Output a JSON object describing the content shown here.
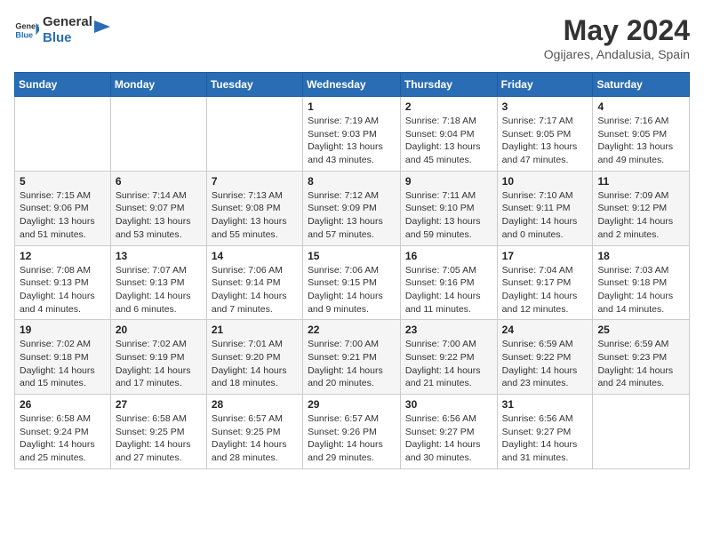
{
  "header": {
    "logo_general": "General",
    "logo_blue": "Blue",
    "month": "May 2024",
    "location": "Ogijares, Andalusia, Spain"
  },
  "weekdays": [
    "Sunday",
    "Monday",
    "Tuesday",
    "Wednesday",
    "Thursday",
    "Friday",
    "Saturday"
  ],
  "weeks": [
    [
      {
        "day": "",
        "info": ""
      },
      {
        "day": "",
        "info": ""
      },
      {
        "day": "",
        "info": ""
      },
      {
        "day": "1",
        "info": "Sunrise: 7:19 AM\nSunset: 9:03 PM\nDaylight: 13 hours\nand 43 minutes."
      },
      {
        "day": "2",
        "info": "Sunrise: 7:18 AM\nSunset: 9:04 PM\nDaylight: 13 hours\nand 45 minutes."
      },
      {
        "day": "3",
        "info": "Sunrise: 7:17 AM\nSunset: 9:05 PM\nDaylight: 13 hours\nand 47 minutes."
      },
      {
        "day": "4",
        "info": "Sunrise: 7:16 AM\nSunset: 9:05 PM\nDaylight: 13 hours\nand 49 minutes."
      }
    ],
    [
      {
        "day": "5",
        "info": "Sunrise: 7:15 AM\nSunset: 9:06 PM\nDaylight: 13 hours\nand 51 minutes."
      },
      {
        "day": "6",
        "info": "Sunrise: 7:14 AM\nSunset: 9:07 PM\nDaylight: 13 hours\nand 53 minutes."
      },
      {
        "day": "7",
        "info": "Sunrise: 7:13 AM\nSunset: 9:08 PM\nDaylight: 13 hours\nand 55 minutes."
      },
      {
        "day": "8",
        "info": "Sunrise: 7:12 AM\nSunset: 9:09 PM\nDaylight: 13 hours\nand 57 minutes."
      },
      {
        "day": "9",
        "info": "Sunrise: 7:11 AM\nSunset: 9:10 PM\nDaylight: 13 hours\nand 59 minutes."
      },
      {
        "day": "10",
        "info": "Sunrise: 7:10 AM\nSunset: 9:11 PM\nDaylight: 14 hours\nand 0 minutes."
      },
      {
        "day": "11",
        "info": "Sunrise: 7:09 AM\nSunset: 9:12 PM\nDaylight: 14 hours\nand 2 minutes."
      }
    ],
    [
      {
        "day": "12",
        "info": "Sunrise: 7:08 AM\nSunset: 9:13 PM\nDaylight: 14 hours\nand 4 minutes."
      },
      {
        "day": "13",
        "info": "Sunrise: 7:07 AM\nSunset: 9:13 PM\nDaylight: 14 hours\nand 6 minutes."
      },
      {
        "day": "14",
        "info": "Sunrise: 7:06 AM\nSunset: 9:14 PM\nDaylight: 14 hours\nand 7 minutes."
      },
      {
        "day": "15",
        "info": "Sunrise: 7:06 AM\nSunset: 9:15 PM\nDaylight: 14 hours\nand 9 minutes."
      },
      {
        "day": "16",
        "info": "Sunrise: 7:05 AM\nSunset: 9:16 PM\nDaylight: 14 hours\nand 11 minutes."
      },
      {
        "day": "17",
        "info": "Sunrise: 7:04 AM\nSunset: 9:17 PM\nDaylight: 14 hours\nand 12 minutes."
      },
      {
        "day": "18",
        "info": "Sunrise: 7:03 AM\nSunset: 9:18 PM\nDaylight: 14 hours\nand 14 minutes."
      }
    ],
    [
      {
        "day": "19",
        "info": "Sunrise: 7:02 AM\nSunset: 9:18 PM\nDaylight: 14 hours\nand 15 minutes."
      },
      {
        "day": "20",
        "info": "Sunrise: 7:02 AM\nSunset: 9:19 PM\nDaylight: 14 hours\nand 17 minutes."
      },
      {
        "day": "21",
        "info": "Sunrise: 7:01 AM\nSunset: 9:20 PM\nDaylight: 14 hours\nand 18 minutes."
      },
      {
        "day": "22",
        "info": "Sunrise: 7:00 AM\nSunset: 9:21 PM\nDaylight: 14 hours\nand 20 minutes."
      },
      {
        "day": "23",
        "info": "Sunrise: 7:00 AM\nSunset: 9:22 PM\nDaylight: 14 hours\nand 21 minutes."
      },
      {
        "day": "24",
        "info": "Sunrise: 6:59 AM\nSunset: 9:22 PM\nDaylight: 14 hours\nand 23 minutes."
      },
      {
        "day": "25",
        "info": "Sunrise: 6:59 AM\nSunset: 9:23 PM\nDaylight: 14 hours\nand 24 minutes."
      }
    ],
    [
      {
        "day": "26",
        "info": "Sunrise: 6:58 AM\nSunset: 9:24 PM\nDaylight: 14 hours\nand 25 minutes."
      },
      {
        "day": "27",
        "info": "Sunrise: 6:58 AM\nSunset: 9:25 PM\nDaylight: 14 hours\nand 27 minutes."
      },
      {
        "day": "28",
        "info": "Sunrise: 6:57 AM\nSunset: 9:25 PM\nDaylight: 14 hours\nand 28 minutes."
      },
      {
        "day": "29",
        "info": "Sunrise: 6:57 AM\nSunset: 9:26 PM\nDaylight: 14 hours\nand 29 minutes."
      },
      {
        "day": "30",
        "info": "Sunrise: 6:56 AM\nSunset: 9:27 PM\nDaylight: 14 hours\nand 30 minutes."
      },
      {
        "day": "31",
        "info": "Sunrise: 6:56 AM\nSunset: 9:27 PM\nDaylight: 14 hours\nand 31 minutes."
      },
      {
        "day": "",
        "info": ""
      }
    ]
  ]
}
